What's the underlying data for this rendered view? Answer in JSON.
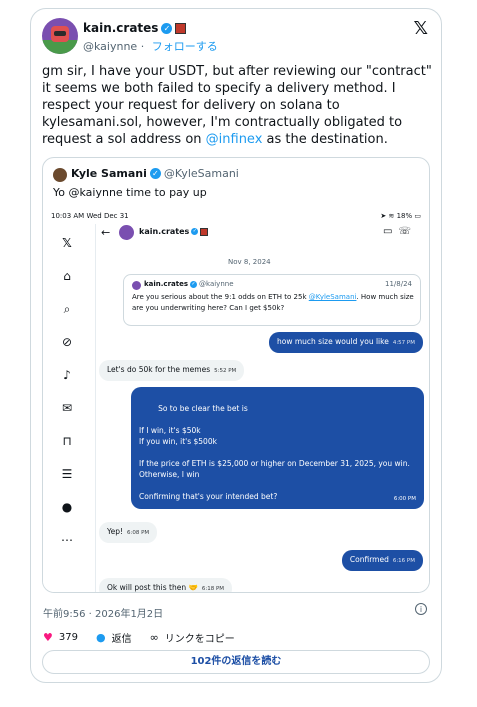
{
  "author": {
    "name": "kain.crates",
    "handle": "@kaiynne",
    "follow_label": "フォローする",
    "verified_mark": "✓"
  },
  "x_logo": "𝕏",
  "tweet": {
    "text_before": "gm sir, I have your USDT, but after reviewing our \"contract\" it seems we both failed to specify a delivery method. I respect your request for delivery on solana to kylesamani.sol, however, I'm contractually obligated to request a sol address on ",
    "mention": "@infinex",
    "text_after": " as the destination."
  },
  "quote": {
    "name": "Kyle Samani",
    "handle": "@KyleSamani",
    "text": "Yo @kaiynne time to pay up",
    "screenshot": {
      "status_time": "10:03 AM  Wed Dec 31",
      "status_right": "➤ ≋ 18% ▭",
      "dm_name": "kain.crates",
      "date_separator": "Nov 8, 2024",
      "inner_quote": {
        "name": "kain.crates",
        "handle": "@kaiynne",
        "date": "11/8/24",
        "text_before": "Are you serious about the 9:1 odds on ETH to 25k ",
        "mention": "@KyleSamani",
        "text_after": ". How much size are you underwriting here? Can I get $50k?"
      },
      "messages": [
        {
          "text": "how much size would you like",
          "time": "4:57 PM"
        },
        {
          "text": "Let's do 50k for the memes",
          "time": "5:52 PM"
        },
        {
          "text": "So to be clear the bet is\n\nIf I win, it's $50k\nIf you win, it's $500k\n\nIf the price of ETH is $25,000 or higher on December 31, 2025, you win. Otherwise, I win\n\nConfirming that's your intended bet?",
          "time": "6:00 PM"
        },
        {
          "text": "Yep!",
          "time": "6:08 PM"
        },
        {
          "text": "Confirmed",
          "time": "6:16 PM"
        },
        {
          "text": "Ok will post this then 🤝",
          "time": "6:18 PM"
        }
      ]
    }
  },
  "timestamp": "午前9:56 · 2026年1月2日",
  "actions": {
    "likes": "379",
    "reply_label": "返信",
    "copy_link_label": "リンクをコピー"
  },
  "read_replies_label": "102件の返信を読む",
  "colors": {
    "accent": "#1d9bf0",
    "bubble_out": "#1d4fa5",
    "like": "#f91880"
  }
}
